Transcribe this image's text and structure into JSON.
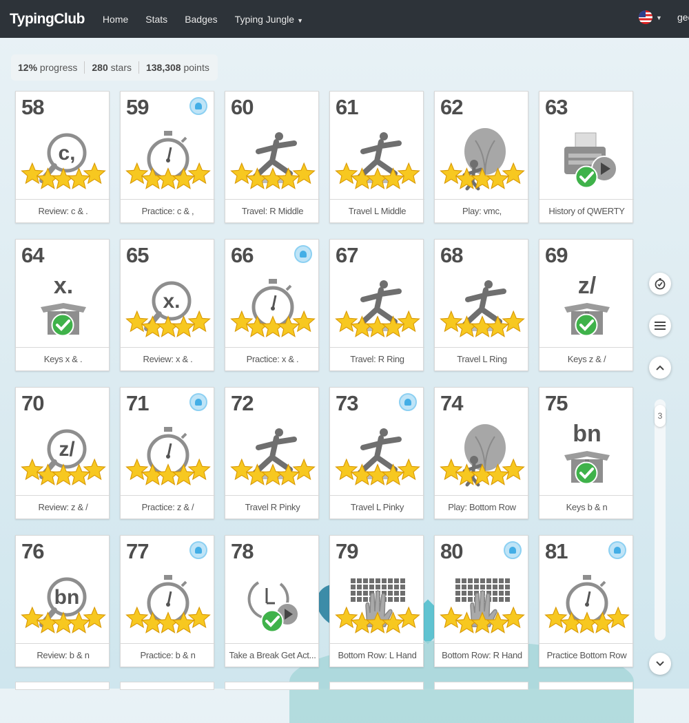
{
  "navbar": {
    "brand": "TypingClub",
    "items": [
      {
        "label": "Home"
      },
      {
        "label": "Stats"
      },
      {
        "label": "Badges"
      },
      {
        "label": "Typing Jungle"
      }
    ],
    "user": "geo"
  },
  "progress": {
    "percent": "12%",
    "percent_label": "progress",
    "stars": "280",
    "stars_label": "stars",
    "points": "138,308",
    "points_label": "points"
  },
  "scroll_page_indicator": "3",
  "colors": {
    "navbar": "#2d3339",
    "star": "#f7c820",
    "check": "#3fb24a",
    "badge": "#43aee6"
  },
  "lessons": [
    {
      "num": "58",
      "title": "Review: c & .",
      "icon": "magnifier",
      "text": "c,",
      "stars": 5,
      "badge": false,
      "complete_check": false
    },
    {
      "num": "59",
      "title": "Practice: c & ,",
      "icon": "stopwatch",
      "stars": 5,
      "badge": true,
      "complete_check": false
    },
    {
      "num": "60",
      "title": "Travel: R Middle",
      "icon": "runner",
      "stars": 5,
      "badge": false,
      "complete_check": false
    },
    {
      "num": "61",
      "title": "Travel L Middle",
      "icon": "runner",
      "stars": 5,
      "badge": false,
      "complete_check": false
    },
    {
      "num": "62",
      "title": "Play: vmc,",
      "icon": "balloon",
      "stars": 5,
      "badge": false,
      "complete_check": false
    },
    {
      "num": "63",
      "title": "History of QWERTY",
      "icon": "typewriter-video",
      "stars": 0,
      "badge": false,
      "complete_check": true
    },
    {
      "num": "64",
      "title": "Keys x & .",
      "icon": "box",
      "text": "x.",
      "stars": 0,
      "badge": false,
      "complete_check": true
    },
    {
      "num": "65",
      "title": "Review: x & .",
      "icon": "magnifier",
      "text": "x.",
      "stars": 5,
      "badge": false,
      "complete_check": false
    },
    {
      "num": "66",
      "title": "Practice: x & .",
      "icon": "stopwatch",
      "stars": 5,
      "badge": true,
      "complete_check": false
    },
    {
      "num": "67",
      "title": "Travel: R Ring",
      "icon": "runner",
      "stars": 5,
      "badge": false,
      "complete_check": false
    },
    {
      "num": "68",
      "title": "Travel L Ring",
      "icon": "runner",
      "stars": 5,
      "badge": false,
      "complete_check": false
    },
    {
      "num": "69",
      "title": "Keys z & /",
      "icon": "box",
      "text": "z/",
      "stars": 0,
      "badge": false,
      "complete_check": true
    },
    {
      "num": "70",
      "title": "Review: z & /",
      "icon": "magnifier",
      "text": "z/",
      "stars": 5,
      "badge": false,
      "complete_check": false
    },
    {
      "num": "71",
      "title": "Practice: z & /",
      "icon": "stopwatch",
      "stars": 5,
      "badge": true,
      "complete_check": false
    },
    {
      "num": "72",
      "title": "Travel R Pinky",
      "icon": "runner",
      "stars": 5,
      "badge": false,
      "complete_check": false
    },
    {
      "num": "73",
      "title": "Travel L Pinky",
      "icon": "runner",
      "stars": 5,
      "badge": true,
      "complete_check": false
    },
    {
      "num": "74",
      "title": "Play: Bottom Row",
      "icon": "balloon",
      "stars": 5,
      "badge": false,
      "complete_check": false
    },
    {
      "num": "75",
      "title": "Keys b & n",
      "icon": "box",
      "text": "bn",
      "stars": 0,
      "badge": false,
      "complete_check": true
    },
    {
      "num": "76",
      "title": "Review: b & n",
      "icon": "magnifier",
      "text": "bn",
      "stars": 5,
      "badge": false,
      "complete_check": false
    },
    {
      "num": "77",
      "title": "Practice: b & n",
      "icon": "stopwatch",
      "stars": 5,
      "badge": true,
      "complete_check": false
    },
    {
      "num": "78",
      "title": "Take a Break Get Act...",
      "icon": "clock-video",
      "stars": 0,
      "badge": false,
      "complete_check": true
    },
    {
      "num": "79",
      "title": "Bottom Row: L Hand",
      "icon": "keyboard-hand",
      "stars": 5,
      "badge": false,
      "complete_check": false
    },
    {
      "num": "80",
      "title": "Bottom Row: R Hand",
      "icon": "keyboard-hand",
      "stars": 5,
      "badge": true,
      "complete_check": false
    },
    {
      "num": "81",
      "title": "Practice Bottom Row",
      "icon": "stopwatch",
      "stars": 5,
      "badge": true,
      "complete_check": false
    }
  ]
}
